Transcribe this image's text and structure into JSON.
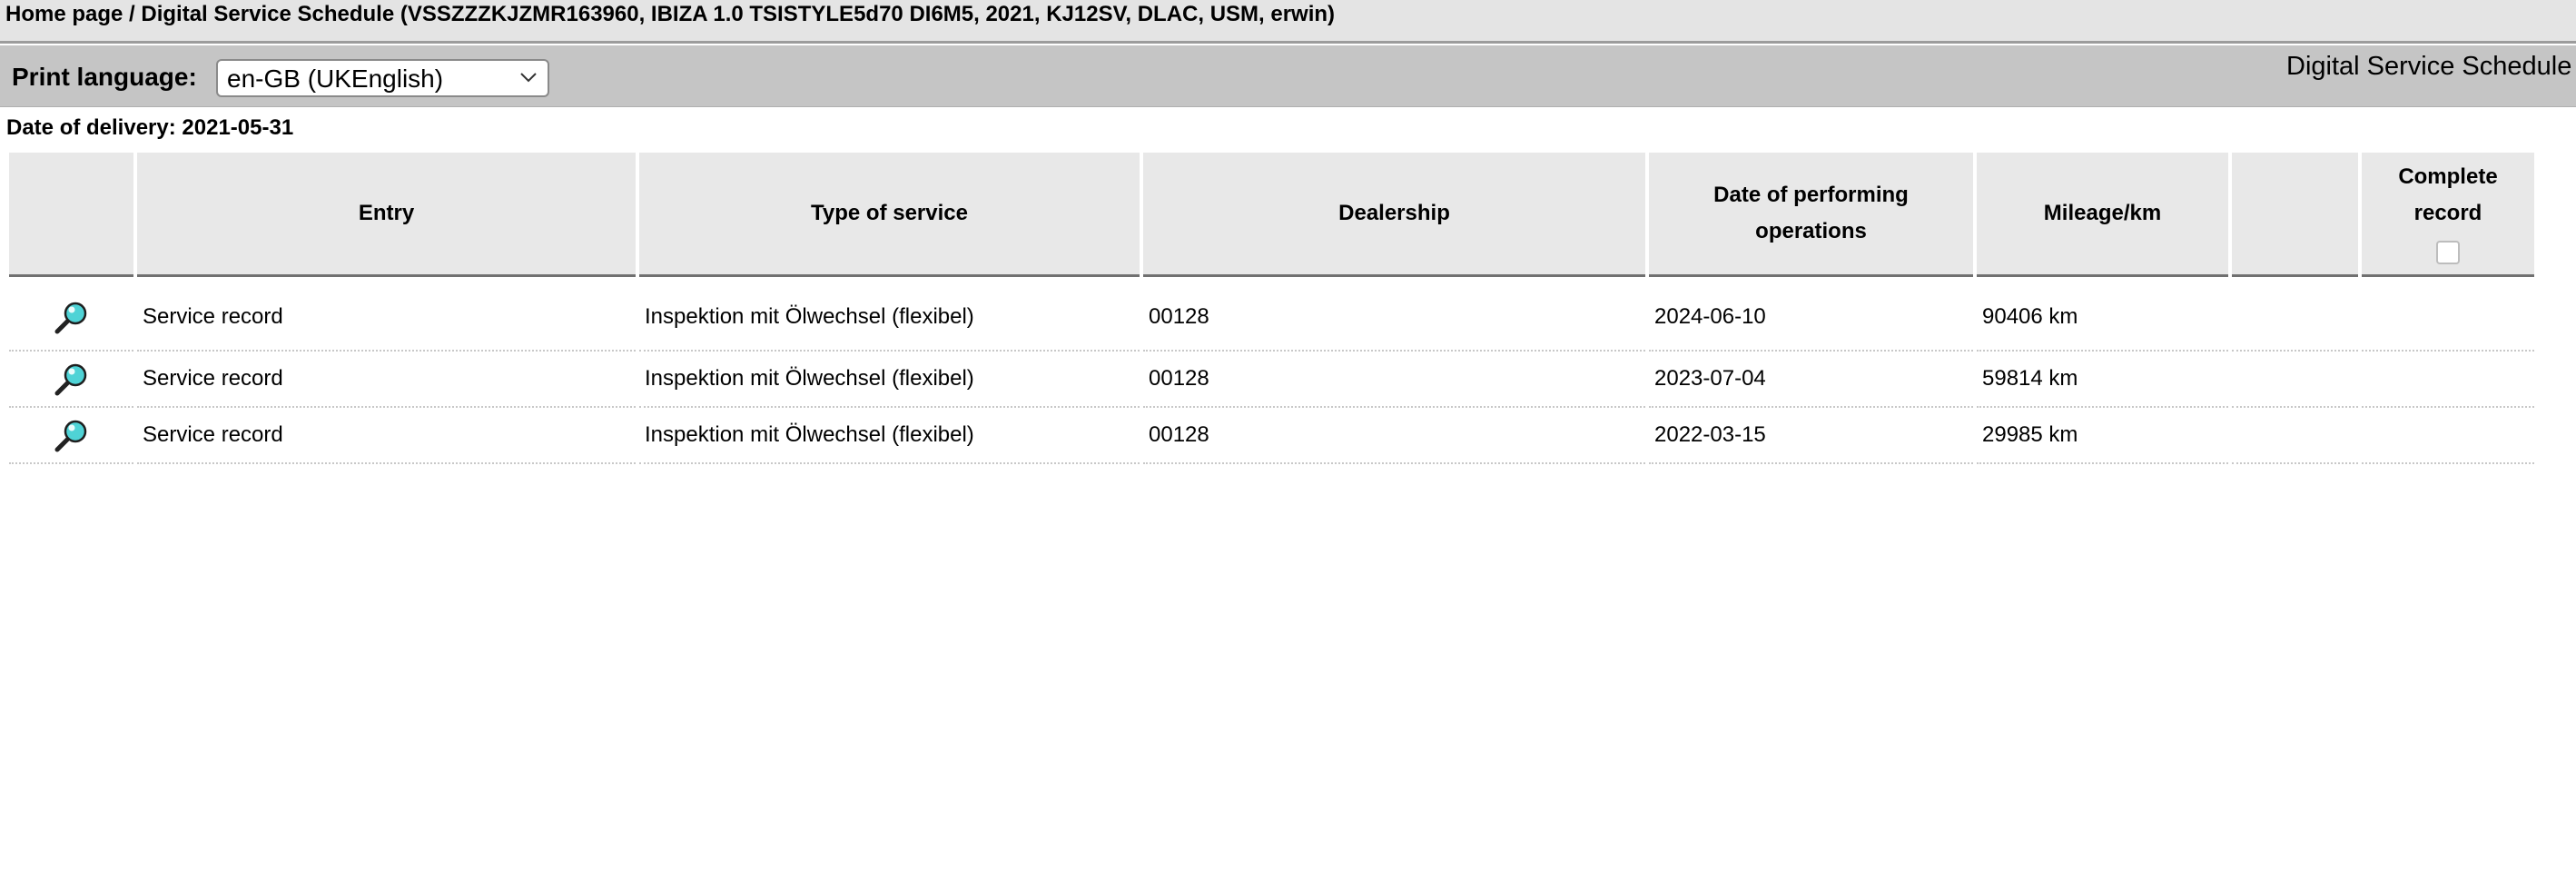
{
  "breadcrumb": {
    "home": "Home page",
    "separator": " / ",
    "current": "Digital Service Schedule (VSSZZZKJZMR163960, IBIZA 1.0 TSISTYLE5d70 DI6M5, 2021, KJ12SV, DLAC, USM, erwin)"
  },
  "toolbar": {
    "print_language_label": "Print language:",
    "print_language_value": "en-GB (UKEnglish)",
    "page_heading": "Digital Service Schedule"
  },
  "delivery": {
    "label": "Date of delivery: 2021-05-31"
  },
  "table": {
    "headers": {
      "entry": "Entry",
      "type_of_service": "Type of service",
      "dealership": "Dealership",
      "date_line1": "Date of performing",
      "date_line2": "operations",
      "mileage": "Mileage/km",
      "complete_line1": "Complete",
      "complete_line2": "record"
    },
    "rows": [
      {
        "entry": "Service record",
        "type": "Inspektion mit Ölwechsel (flexibel)",
        "dealership": "00128",
        "date": "2024-06-10",
        "mileage": "90406 km"
      },
      {
        "entry": "Service record",
        "type": "Inspektion mit Ölwechsel (flexibel)",
        "dealership": "00128",
        "date": "2023-07-04",
        "mileage": "59814 km"
      },
      {
        "entry": "Service record",
        "type": "Inspektion mit Ölwechsel (flexibel)",
        "dealership": "00128",
        "date": "2022-03-15",
        "mileage": "29985 km"
      }
    ]
  },
  "icons": {
    "row_action": "magnifier-icon",
    "select_chevron": "chevron-down-icon"
  },
  "colors": {
    "breadcrumb_bar": "#e4e4e4",
    "toolbar": "#c5c5c5",
    "header_cell": "#e8e8e8",
    "magnifier_lens": "#4fd3d6"
  }
}
